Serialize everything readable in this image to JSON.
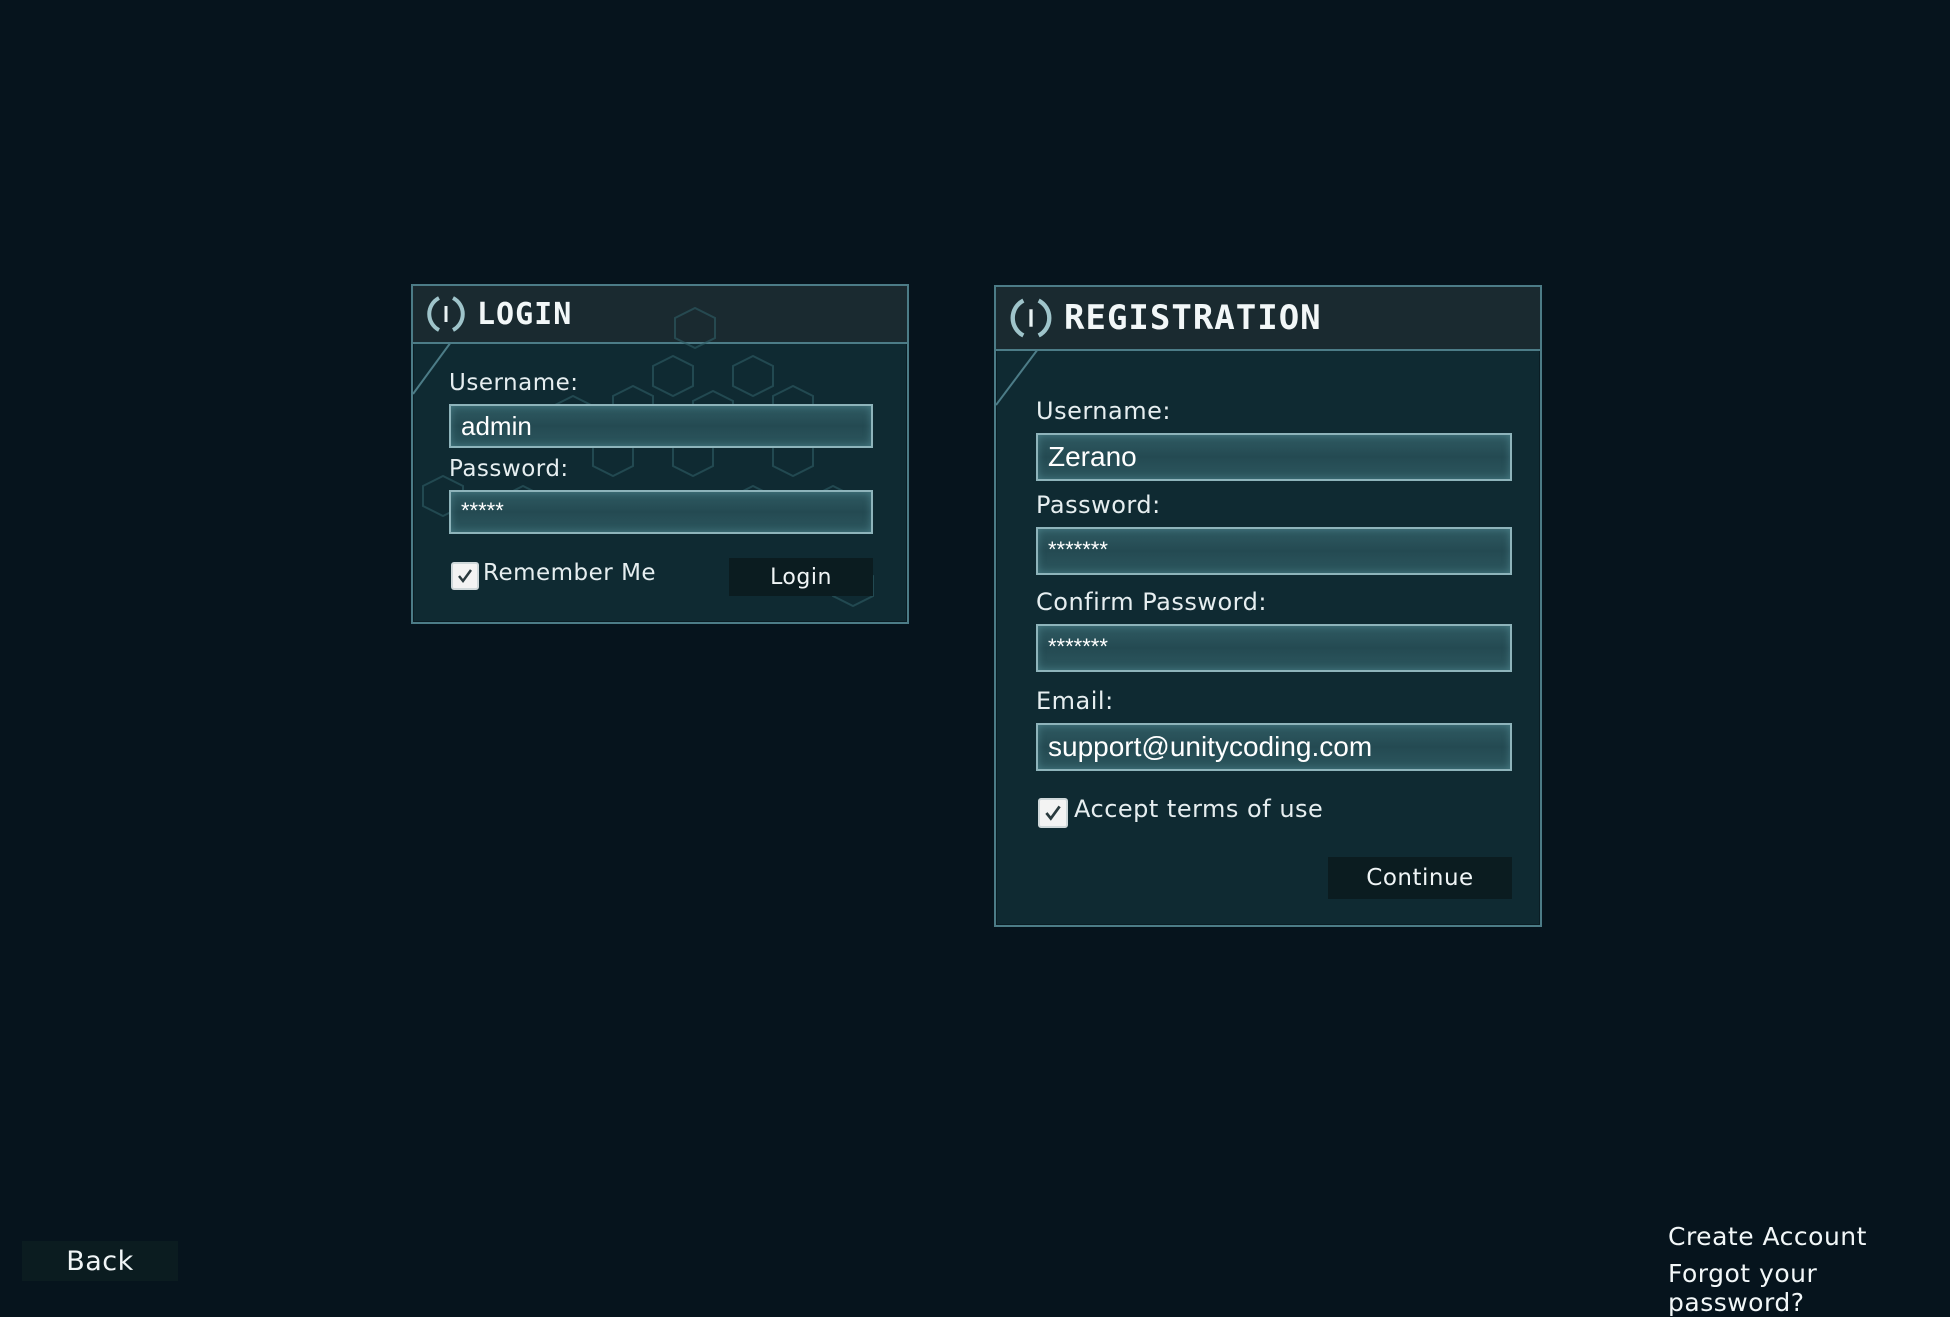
{
  "login": {
    "title": "Login",
    "username_label": "Username:",
    "username_value": "admin",
    "password_label": "Password:",
    "password_value": "*****",
    "remember_label": "Remember Me",
    "remember_checked": true,
    "login_button": "Login"
  },
  "registration": {
    "title": "Registration",
    "username_label": "Username:",
    "username_value": "Zerano",
    "password_label": "Password:",
    "password_value": "*******",
    "confirm_label": "Confirm Password:",
    "confirm_value": "*******",
    "email_label": "Email:",
    "email_value": "support@unitycoding.com",
    "terms_label": "Accept terms of use",
    "terms_checked": true,
    "continue_button": "Continue"
  },
  "footer": {
    "back_label": "Back",
    "create_account": "Create Account",
    "forgot_password": "Forgot your password?"
  },
  "icons": {
    "panel_icon": "power-icon",
    "checkbox_icon": "checkmark-icon"
  },
  "colors": {
    "background": "#06141d",
    "panel": "#0f2a32",
    "panel_border": "#4c7c87",
    "field_border": "#8eb4bb"
  }
}
